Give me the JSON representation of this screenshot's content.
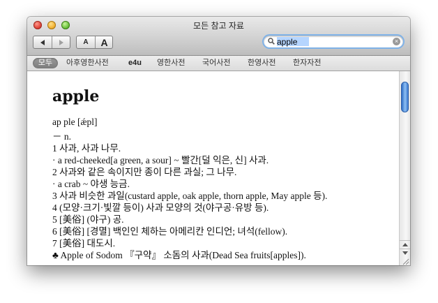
{
  "window": {
    "title": "모든 참고 자료"
  },
  "toolbar": {
    "font_small_label": "A",
    "font_large_label": "A"
  },
  "search": {
    "value": "apple",
    "clear_glyph": "×"
  },
  "scope_tabs": [
    "모두",
    "아후영한사전",
    "e4u",
    "영한사전",
    "국어사전",
    "한영사전",
    "한자자전"
  ],
  "entry": {
    "title": "apple",
    "lines": [
      "ap ple [ǽpl]",
      "－ n.",
      "1 사과, 사과 나무.",
      "· a red-cheeked[a green, a sour] ~ 빨간[덜 익은, 신] 사과.",
      "2 사과와 같은 속이지만 종이 다른 과실; 그 나무.",
      "· a crab ~ 야생 능금.",
      "3 사과 비슷한 과일(custard apple, oak apple, thorn apple, May apple 등).",
      "4 (모양·크기·빛깔 등이) 사과 모양의 것(야구공·유방 등).",
      "5 [美俗] (야구) 공.",
      "6 [美俗] [경멸] 백인인 체하는 아메리칸 인디언; 녀석(fellow).",
      "7 [美俗] 대도시.",
      "♣ Apple of Sodom 『구약』 소돔의 사과(Dead Sea fruits[apples])."
    ]
  },
  "colors": {
    "accent": "#3b78cf",
    "search_focus": "#7fb2e8",
    "selection": "#b5d5ff"
  },
  "icons": [
    "back-arrow-icon",
    "forward-arrow-icon",
    "search-icon",
    "clear-icon",
    "scroll-up-icon",
    "scroll-down-icon",
    "resize-grip-icon"
  ]
}
